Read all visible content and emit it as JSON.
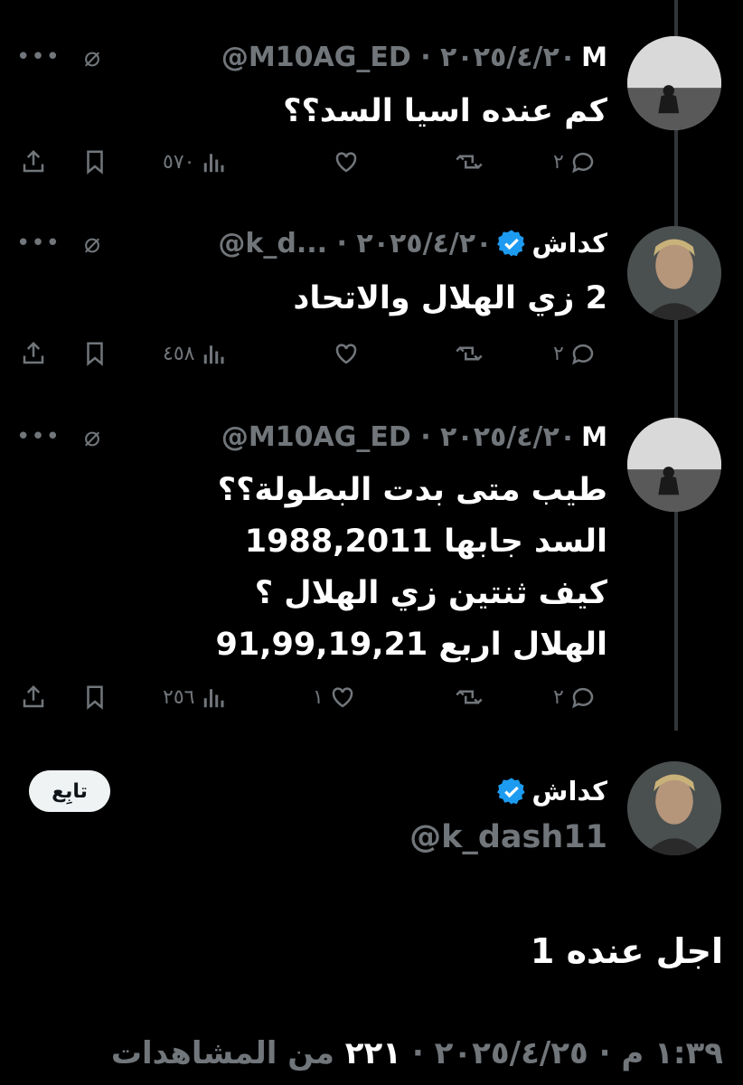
{
  "thread": [
    {
      "display_name": "M",
      "handle_meta": "@M10AG_ED · ٢٠٢٥/٤/٢٠",
      "verified": false,
      "text_lines": [
        "كم عنده اسيا السد؟؟"
      ],
      "counts": {
        "replies": "٢",
        "retweets": "",
        "likes": "",
        "views": "٥٧٠"
      }
    },
    {
      "display_name": "كداش",
      "handle_meta": "@k_d... · ٢٠٢٥/٤/٢٠",
      "verified": true,
      "text_lines": [
        "2 زي الهلال والاتحاد"
      ],
      "counts": {
        "replies": "٢",
        "retweets": "",
        "likes": "",
        "views": "٤٥٨"
      }
    },
    {
      "display_name": "M",
      "handle_meta": "@M10AG_ED · ٢٠٢٥/٤/٢٠",
      "verified": false,
      "text_lines": [
        "طيب متى بدت البطولة؟؟",
        "السد جابها 1988,2011",
        "كيف ثنتين زي الهلال ؟",
        "الهلال اربع 91,99,19,21"
      ],
      "counts": {
        "replies": "٢",
        "retweets": "",
        "likes": "١",
        "views": "٢٥٦"
      }
    }
  ],
  "main_tweet": {
    "display_name": "كداش",
    "handle": "@k_dash11",
    "follow_label": "تابِع",
    "text": "اجل عنده 1",
    "timestamp": "١:٣٩ م · ٢٠٢٥/٤/٢٥ ·",
    "views_count": "٢٢١",
    "views_label": "من المشاهدات"
  },
  "icons": [
    "more-icon",
    "grok-icon",
    "reply-icon",
    "retweet-icon",
    "like-icon",
    "views-icon",
    "bookmark-icon",
    "share-icon",
    "verified-badge-icon"
  ],
  "colors": {
    "background": "#000000",
    "text": "#e7e9ea",
    "muted": "#71767b",
    "verified": "#1d9bf0",
    "follow_bg": "#eff3f4"
  }
}
